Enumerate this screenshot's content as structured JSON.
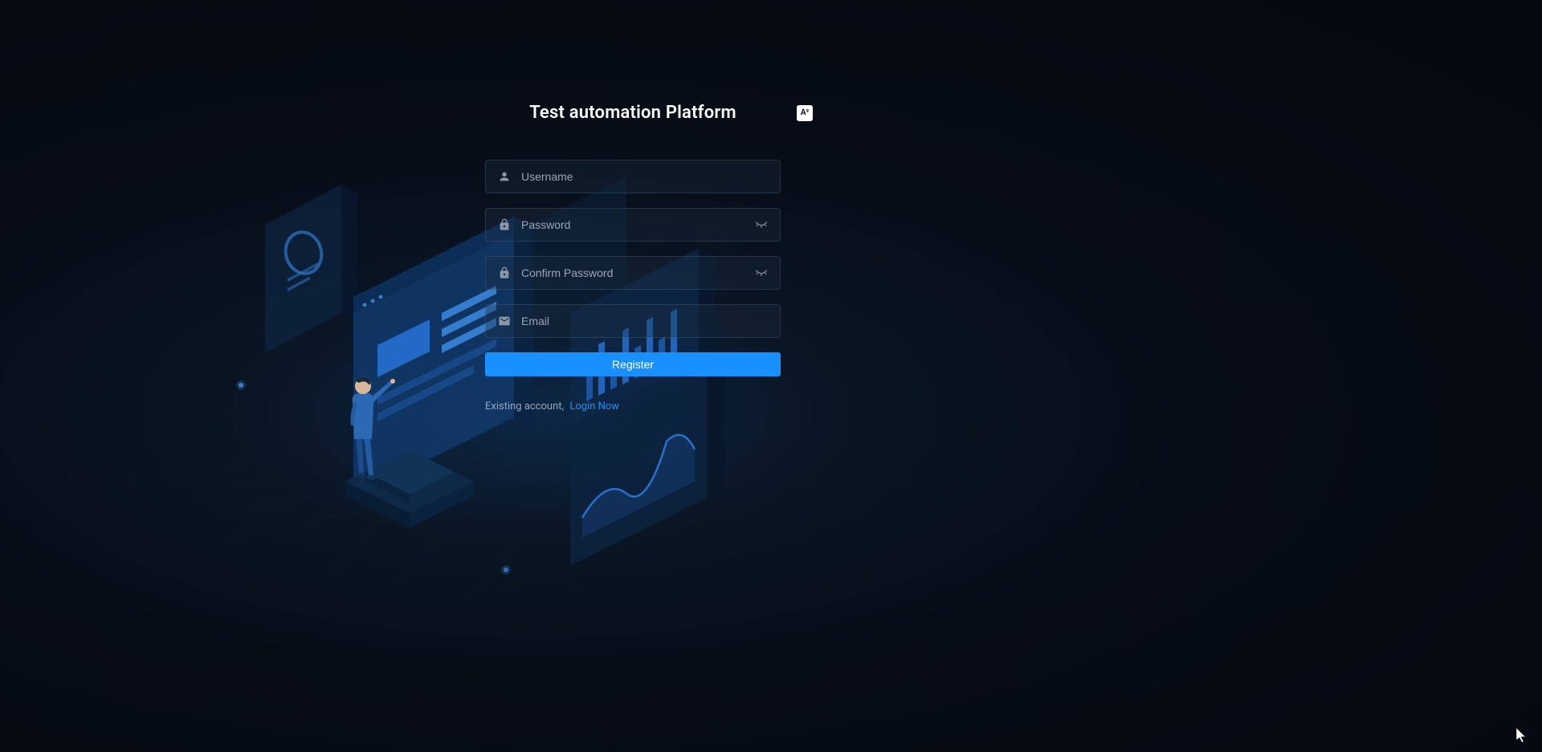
{
  "title": "Test automation Platform",
  "lang_badge": "A²",
  "fields": {
    "username": {
      "placeholder": "Username",
      "value": ""
    },
    "password": {
      "placeholder": "Password",
      "value": ""
    },
    "confirm_password": {
      "placeholder": "Confirm Password",
      "value": ""
    },
    "email": {
      "placeholder": "Email",
      "value": ""
    }
  },
  "register_button": "Register",
  "footer": {
    "existing_text": "Existing account, ",
    "login_link": "Login Now"
  }
}
